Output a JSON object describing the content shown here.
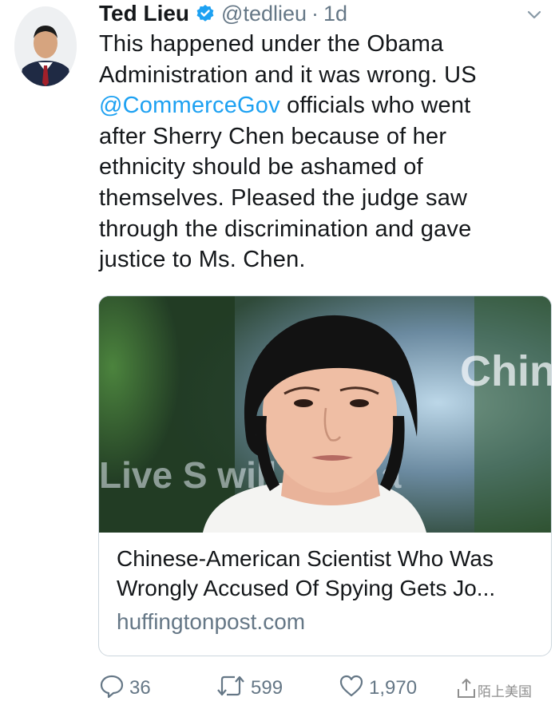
{
  "tweet": {
    "author_name": "Ted Lieu",
    "handle": "@tedlieu",
    "separator": "·",
    "time": "1d",
    "lines": [
      "This happened under the Obama",
      "Administration and it was wrong. US",
      "officials who went",
      "after Sherry Chen because of her",
      "ethnicity should be ashamed of",
      "themselves. Pleased the judge saw",
      "through the discrimination and gave",
      "justice to Ms. Chen."
    ],
    "mention": "@CommerceGov"
  },
  "card": {
    "title_lines": [
      "Chinese-American Scientist Who Was",
      "Wrongly Accused Of Spying Gets Jo..."
    ],
    "domain": "huffingtonpost.com",
    "image_overlay_text": {
      "top": "Chin",
      "bottom": "Live S       will Start a"
    }
  },
  "actions": {
    "replies": "36",
    "retweets": "599",
    "likes": "1,970"
  },
  "watermark": {
    "text": "陌上美国"
  },
  "colors": {
    "link": "#1da1f2",
    "secondary": "#657786",
    "verified": "#1da1f2"
  },
  "icons": [
    "verified-badge-icon",
    "chevron-down-icon",
    "reply-icon",
    "retweet-icon",
    "like-icon",
    "share-icon"
  ]
}
